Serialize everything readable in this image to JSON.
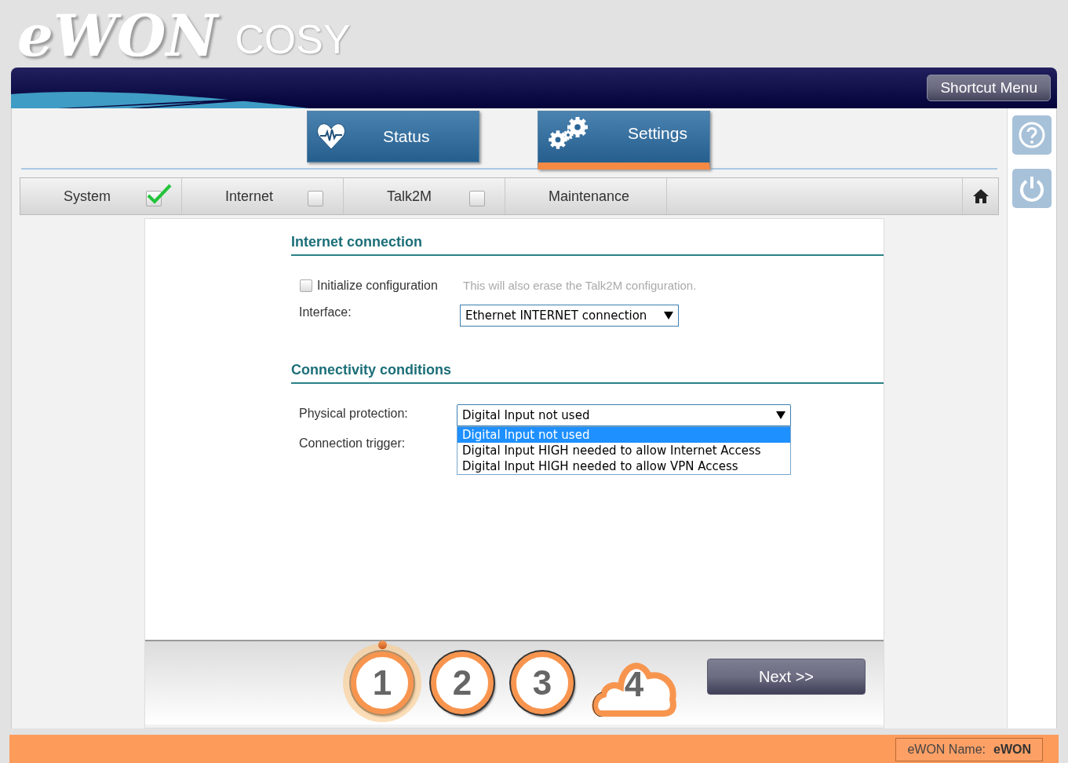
{
  "logo": {
    "brand": "eWON",
    "product": "COSY"
  },
  "header": {
    "shortcut_button": "Shortcut Menu"
  },
  "main_tabs": [
    {
      "label": "Status",
      "kind": "heart",
      "selected": false
    },
    {
      "label": "Settings",
      "kind": "gears",
      "selected": true
    }
  ],
  "steps": [
    {
      "label": "System",
      "kind": "checkbox",
      "checked": true
    },
    {
      "label": "Internet",
      "kind": "checkbox",
      "checked": false
    },
    {
      "label": "Talk2M",
      "kind": "checkbox",
      "checked": false
    },
    {
      "label": "Maintenance",
      "kind": "plain"
    }
  ],
  "internet_connection": {
    "title": "Internet connection",
    "initialize": {
      "label": "Initialize configuration",
      "checked": false,
      "hint": "This will also erase the Talk2M configuration."
    },
    "interface": {
      "label": "Interface:",
      "value": "Ethernet INTERNET connection"
    }
  },
  "connectivity_conditions": {
    "title": "Connectivity conditions",
    "physical_protection": {
      "label": "Physical protection:",
      "value": "Digital Input not used",
      "expanded": true,
      "options": [
        {
          "label": "Digital Input not used",
          "selected": true
        },
        {
          "label": "Digital Input HIGH needed to allow Internet Access",
          "selected": false
        },
        {
          "label": "Digital Input HIGH needed to allow VPN Access",
          "selected": false
        }
      ]
    },
    "connection_trigger": {
      "label": "Connection trigger:"
    }
  },
  "wizard": {
    "steps": [
      {
        "label": "1",
        "kind": "circle",
        "selected": true
      },
      {
        "label": "2",
        "kind": "circle",
        "selected": false
      },
      {
        "label": "3",
        "kind": "circle",
        "selected": false
      },
      {
        "label": "4",
        "kind": "cloud",
        "selected": false
      }
    ],
    "next_button": "Next >>"
  },
  "footer": {
    "name_label": "eWON Name:",
    "name_value": "eWON"
  }
}
